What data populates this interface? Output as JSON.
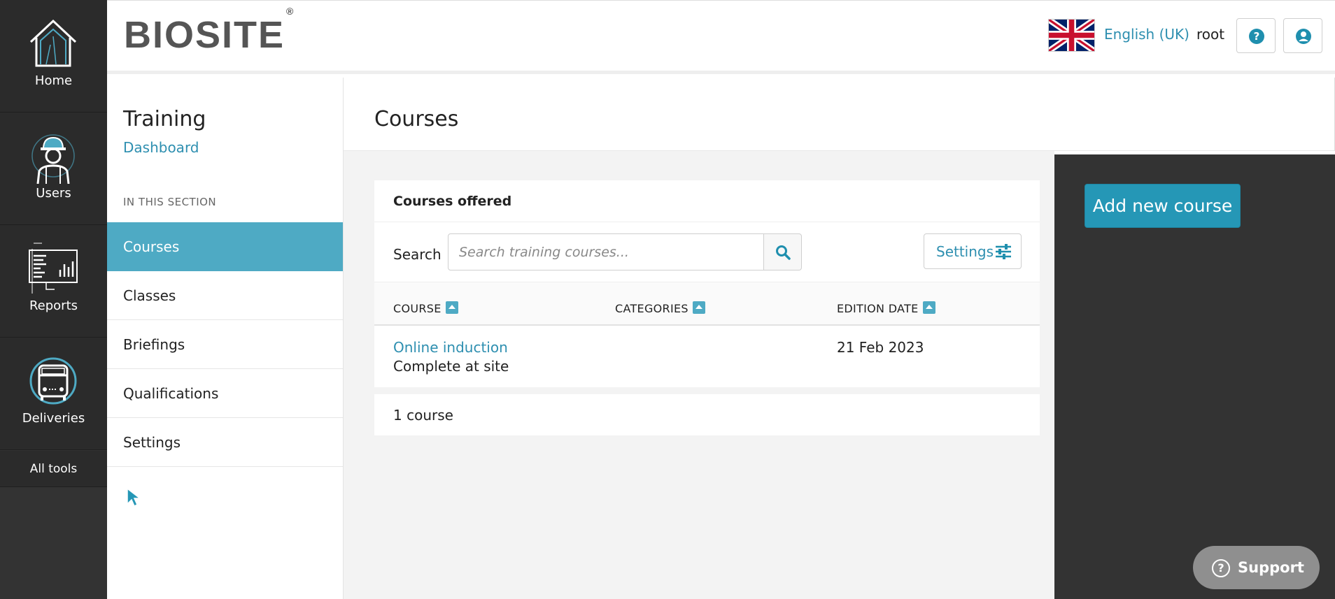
{
  "leftnav": {
    "items": [
      {
        "label": "Home",
        "icon": "home-icon"
      },
      {
        "label": "Users",
        "icon": "worker-icon"
      },
      {
        "label": "Reports",
        "icon": "reports-icon"
      },
      {
        "label": "Deliveries",
        "icon": "truck-icon"
      }
    ],
    "all_tools": "All tools"
  },
  "header": {
    "logo": "BIOSITE",
    "logo_mark": "®",
    "language": "English (UK)",
    "user": "root",
    "help_icon": "question-icon",
    "account_icon": "user-circle-icon"
  },
  "section": {
    "title": "Training",
    "dashboard_link": "Dashboard",
    "heading": "IN THIS SECTION",
    "items": [
      "Courses",
      "Classes",
      "Briefings",
      "Qualifications",
      "Settings"
    ],
    "active": "Courses"
  },
  "main": {
    "title": "Courses",
    "panel": {
      "title": "Courses offered",
      "search_label": "Search",
      "search_placeholder": "Search training courses...",
      "settings_label": "Settings",
      "columns": [
        "COURSE",
        "CATEGORIES",
        "EDITION DATE"
      ],
      "rows": [
        {
          "course": "Online induction",
          "subtitle": "Complete at site",
          "categories": "",
          "edition_date": "21 Feb 2023"
        }
      ]
    },
    "count": "1 course"
  },
  "actions": {
    "add_course": "Add new course"
  },
  "support": {
    "label": "Support"
  },
  "colors": {
    "accent": "#2e8fb0",
    "active_nav": "#4eaac4",
    "dark_bg": "#333333",
    "button": "#2597b6"
  }
}
